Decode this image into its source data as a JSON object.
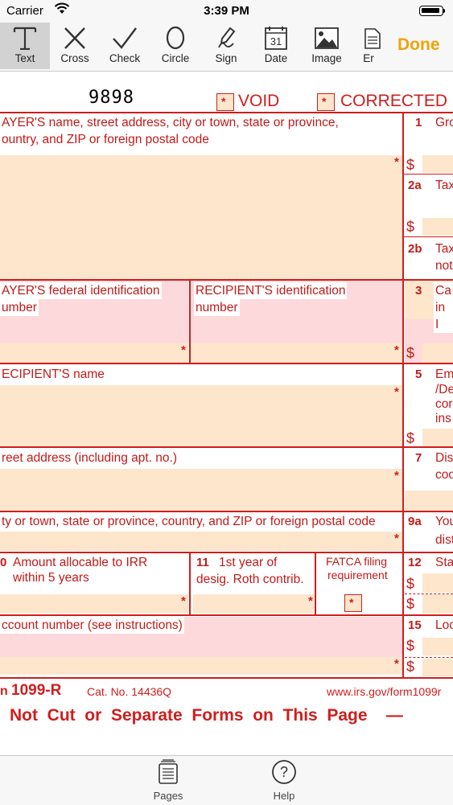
{
  "status_bar": {
    "carrier": "Carrier",
    "time": "3:39 PM"
  },
  "toolbar": {
    "tools": [
      {
        "label": "Text",
        "icon": "text-cursor-icon",
        "active": true
      },
      {
        "label": "Cross",
        "icon": "cross-icon"
      },
      {
        "label": "Check",
        "icon": "checkmark-icon"
      },
      {
        "label": "Circle",
        "icon": "circle-icon"
      },
      {
        "label": "Sign",
        "icon": "signature-pen-icon"
      },
      {
        "label": "Date",
        "icon": "calendar-icon",
        "date_day": "31"
      },
      {
        "label": "Image",
        "icon": "image-icon"
      },
      {
        "label": "Er",
        "icon": "eraser-icon"
      }
    ],
    "done_label": "Done",
    "accent_color": "#f0a30a"
  },
  "form": {
    "form_number_code": "9898",
    "void_label": "VOID",
    "corrected_label": "CORRECTED",
    "payer_label_1": "AYER'S name, street address, city or town, state or province,",
    "payer_label_2": "ountry, and ZIP or foreign postal code",
    "box1_num": "1",
    "box1_label": "Gro",
    "box2a_num": "2a",
    "box2a_label": "Tax",
    "box2b_num": "2b",
    "box2b_label_1": "Tax",
    "box2b_label_2": "not",
    "payer_tin_label_1": "AYER'S federal identification",
    "payer_tin_label_2": "umber",
    "recipient_tin_label_1": "RECIPIENT'S identification",
    "recipient_tin_label_2": "number",
    "box3_num": "3",
    "box3_label_1": "Ca",
    "box3_label_2": "in I",
    "recipient_name_label": "ECIPIENT'S name",
    "box5_num": "5",
    "box5_label_1": "Em",
    "box5_label_2": "/De",
    "box5_label_3": "cor",
    "box5_label_4": "ins",
    "street_label": "reet address (including apt. no.)",
    "box7_num": "7",
    "box7_label_1": "Dis",
    "box7_label_2": "coo",
    "city_label": "ty or town, state or province, country, and ZIP or foreign postal code",
    "box9a_num": "9a",
    "box9a_label_1": "You",
    "box9a_label_2": "dist",
    "box10_num": "0",
    "box10_label_1": "Amount allocable to IRR",
    "box10_label_2": "within 5 years",
    "box11_num": "11",
    "box11_label_1": "1st year of",
    "box11_label_2": "desig. Roth contrib.",
    "fatca_label_1": "FATCA filing",
    "fatca_label_2": "requirement",
    "box12_num": "12",
    "box12_label": "Sta",
    "account_label": "ccount number (see instructions)",
    "box15_num": "15",
    "box15_label": "Loc",
    "currency_symbol": "$",
    "required_mark": "*",
    "form_prefix": "n",
    "form_name": "1099-R",
    "cat_no": "Cat. No. 14436Q",
    "website": "www.irs.gov/form1099r",
    "warning": "Not  Cut  or  Separate  Forms  on  This  Page    —"
  },
  "tabbar": {
    "tabs": [
      {
        "label": "Pages",
        "icon": "pages-icon"
      },
      {
        "label": "Help",
        "icon": "help-icon"
      }
    ]
  }
}
